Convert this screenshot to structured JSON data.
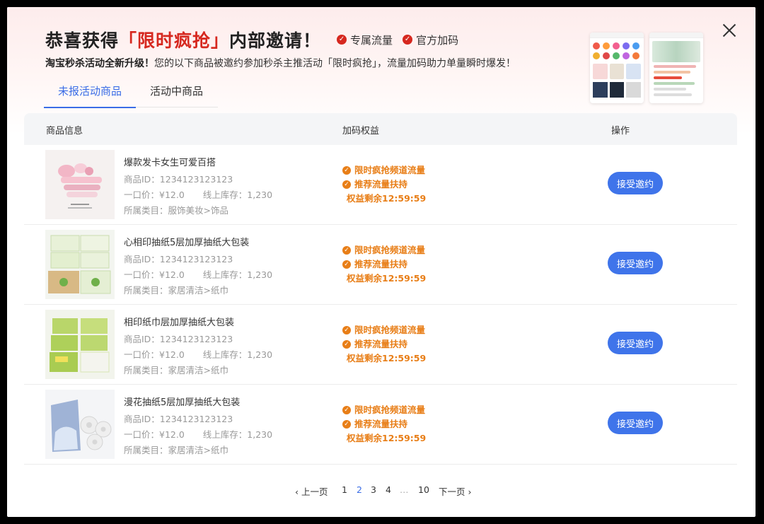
{
  "header": {
    "title_prefix": "恭喜获得",
    "title_highlight": "「限时疯抢」",
    "title_suffix": "内部邀请！",
    "perks": [
      "专属流量",
      "官方加码"
    ],
    "subtitle_bold": "淘宝秒杀活动全新升级！",
    "subtitle_rest": "您的以下商品被邀约参加秒杀主推活动「限时疯抢」，流量加码助力单量瞬时爆发！"
  },
  "tabs": [
    {
      "label": "未报活动商品",
      "active": true
    },
    {
      "label": "活动中商品",
      "active": false
    }
  ],
  "table": {
    "headers": {
      "product": "商品信息",
      "benefit": "加码权益",
      "action": "操作"
    },
    "rows": [
      {
        "name": "爆款发卡女生可爱百搭",
        "id_text": "商品ID：1234123123123",
        "price_text": "一口价：¥12.0",
        "stock_text": "线上库存：1,230",
        "category_text": "所属类目：服饰美妆>饰品",
        "image": "pink-hair-clips",
        "benefits": [
          "限时疯抢频道流量",
          "推荐流量扶持"
        ],
        "timer_text": "权益剩余12:59:59",
        "action_label": "接受邀约"
      },
      {
        "name": "心相印抽纸5层加厚抽纸大包装",
        "id_text": "商品ID：1234123123123",
        "price_text": "一口价：¥12.0",
        "stock_text": "线上库存：1,230",
        "category_text": "所属类目：家居清洁>纸巾",
        "image": "tissue-packs-green",
        "benefits": [
          "限时疯抢频道流量",
          "推荐流量扶持"
        ],
        "timer_text": "权益剩余12:59:59",
        "action_label": "接受邀约"
      },
      {
        "name": "相印纸巾层加厚抽纸大包装",
        "id_text": "商品ID：1234123123123",
        "price_text": "一口价：¥12.0",
        "stock_text": "线上库存：1,230",
        "category_text": "所属类目：家居清洁>纸巾",
        "image": "tissue-packs-yellow-green",
        "benefits": [
          "限时疯抢频道流量",
          "推荐流量扶持"
        ],
        "timer_text": "权益剩余12:59:59",
        "action_label": "接受邀约"
      },
      {
        "name": "漫花抽纸5层加厚抽纸大包装",
        "id_text": "商品ID：1234123123123",
        "price_text": "一口价：¥12.0",
        "stock_text": "线上库存：1,230",
        "category_text": "所属类目：家居清洁>纸巾",
        "image": "tissue-rolls-blue",
        "benefits": [
          "限时疯抢频道流量",
          "推荐流量扶持"
        ],
        "timer_text": "权益剩余12:59:59",
        "action_label": "接受邀约"
      }
    ]
  },
  "pagination": {
    "prev_label": "上一页",
    "pages": [
      "1",
      "2",
      "3",
      "4"
    ],
    "current": "2",
    "ellipsis": "…",
    "last": "10",
    "next_label": "下一页"
  },
  "colors": {
    "accent_blue": "#3a6de6",
    "highlight_red": "#d6281f",
    "benefit_orange": "#e87e17",
    "button_blue": "#3f74ea"
  },
  "icons": [
    "check-circle-icon",
    "close-icon",
    "chevron-left-icon",
    "chevron-right-icon"
  ]
}
